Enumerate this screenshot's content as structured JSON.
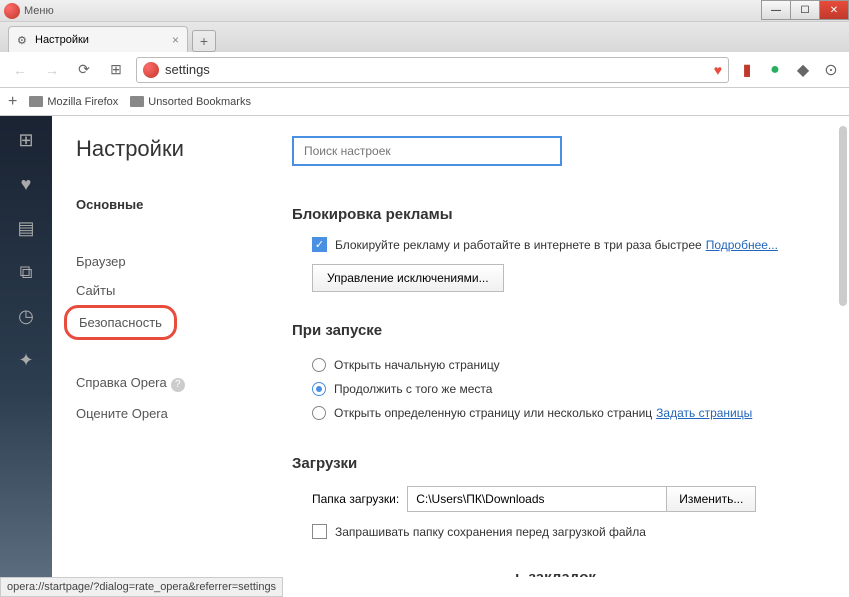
{
  "window": {
    "title": "Меню"
  },
  "tab": {
    "title": "Настройки"
  },
  "url": "settings",
  "bookmarks": {
    "add_label": "+",
    "item1": "Mozilla Firefox",
    "item2": "Unsorted Bookmarks"
  },
  "settings": {
    "title": "Настройки",
    "nav": {
      "basic": "Основные",
      "browser": "Браузер",
      "sites": "Сайты",
      "security": "Безопасность",
      "help": "Справка Opera",
      "rate": "Оцените Opera"
    },
    "search_placeholder": "Поиск настроек",
    "adblock": {
      "title": "Блокировка рекламы",
      "checkbox_label": "Блокируйте рекламу и работайте в интернете в три раза быстрее",
      "more_link": "Подробнее...",
      "manage_btn": "Управление исключениями..."
    },
    "startup": {
      "title": "При запуске",
      "option1": "Открыть начальную страницу",
      "option2": "Продолжить с того же места",
      "option3": "Открыть определенную страницу или несколько страниц",
      "set_pages_link": "Задать страницы"
    },
    "downloads": {
      "title": "Загрузки",
      "folder_label": "Папка загрузки:",
      "folder_value": "C:\\Users\\ПК\\Downloads",
      "change_btn": "Изменить...",
      "ask_label": "Запрашивать папку сохранения перед загрузкой файла"
    },
    "bookmarks_panel_title": "ь закладок"
  },
  "status_text": "opera://startpage/?dialog=rate_opera&referrer=settings"
}
